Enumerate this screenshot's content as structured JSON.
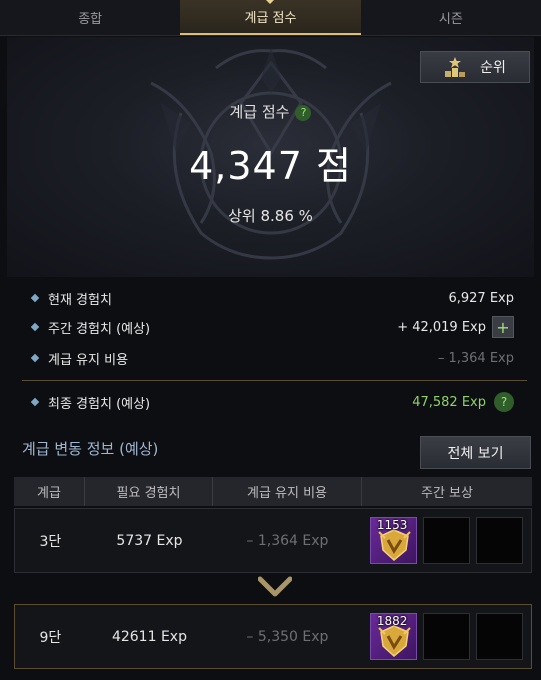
{
  "tabs": [
    "종합",
    "계급 점수",
    "시즌"
  ],
  "hero": {
    "rank_button": "순위",
    "label": "계급 점수",
    "help": "?",
    "score": "4,347 점",
    "rank_percent": "상위 8.86 %"
  },
  "exp": {
    "current_label": "현재 경험치",
    "current_value": "6,927 Exp",
    "weekly_label": "주간 경험치 (예상)",
    "weekly_value": "+ 42,019 Exp",
    "plus": "+",
    "upkeep_label": "계급 유지 비용",
    "upkeep_value": "– 1,364 Exp",
    "final_label": "최종 경험치 (예상)",
    "final_value": "47,582 Exp",
    "help": "?"
  },
  "section": {
    "title": "계급 변동 정보 (예상)",
    "view_all": "전체 보기"
  },
  "table": {
    "headers": [
      "계급",
      "필요 경험치",
      "계급 유지 비용",
      "주간 보상"
    ],
    "rows": [
      {
        "tier": "3단",
        "required": "5737 Exp",
        "upkeep": "– 1,364 Exp",
        "reward_qty": "1153"
      },
      {
        "tier": "9단",
        "required": "42611 Exp",
        "upkeep": "– 5,350 Exp",
        "reward_qty": "1882"
      }
    ]
  },
  "icons": {
    "rank": "podium-star-icon",
    "reward": "gold-shield-medal-icon",
    "chevron": "chevron-down-icon"
  },
  "colors": {
    "accent_gold": "#d9bf7a",
    "green": "#8fd16a",
    "section_blue": "#9fb6d0",
    "reward_purple": "#6a2a9a"
  }
}
